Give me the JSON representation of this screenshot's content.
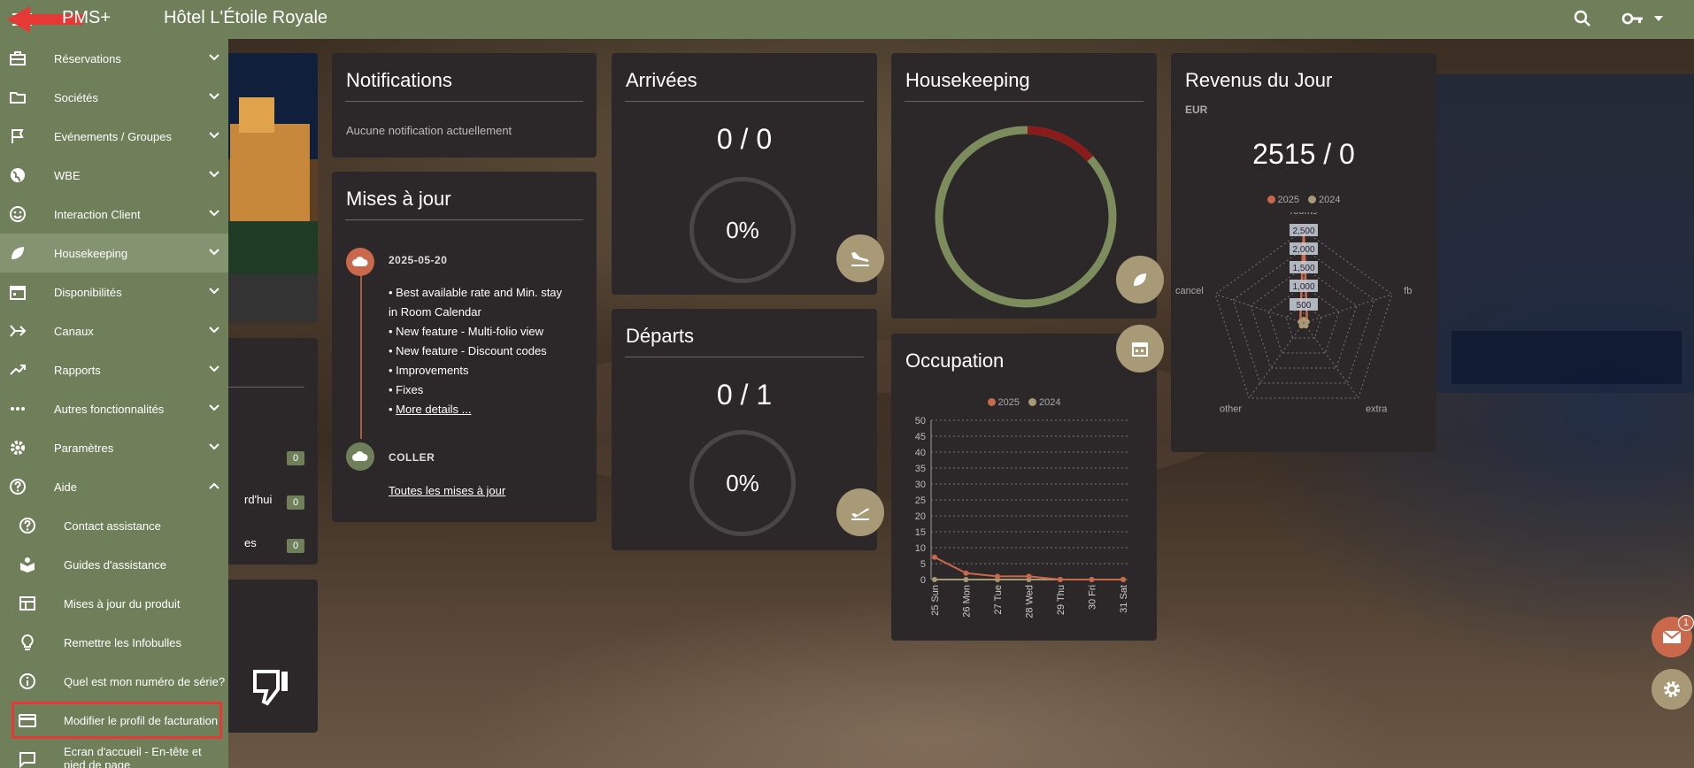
{
  "app": {
    "name": "PMS+",
    "hotel": "Hôtel L'Étoile Royale"
  },
  "colors": {
    "olive": "#6f7f5a",
    "accent": "#c9684a",
    "tan": "#a89a76",
    "red": "#8b1a1a"
  },
  "sidebar": {
    "items": [
      {
        "label": "Réservations",
        "icon": "briefcase-icon"
      },
      {
        "label": "Sociétés",
        "icon": "folder-icon"
      },
      {
        "label": "Evénements / Groupes",
        "icon": "flag-icon"
      },
      {
        "label": "WBE",
        "icon": "globe-icon"
      },
      {
        "label": "Interaction Client",
        "icon": "smiley-icon"
      },
      {
        "label": "Housekeeping",
        "icon": "leaf-icon"
      },
      {
        "label": "Disponibilités",
        "icon": "calendar-icon"
      },
      {
        "label": "Canaux",
        "icon": "channels-icon"
      },
      {
        "label": "Rapports",
        "icon": "trending-icon"
      },
      {
        "label": "Autres fonctionnalités",
        "icon": "more-icon"
      },
      {
        "label": "Paramètres",
        "icon": "gear-icon"
      },
      {
        "label": "Aide",
        "icon": "help-icon"
      }
    ],
    "help_items": [
      {
        "label": "Contact assistance",
        "icon": "help-circle-icon"
      },
      {
        "label": "Guides d'assistance",
        "icon": "book-icon"
      },
      {
        "label": "Mises à jour du produit",
        "icon": "table-icon"
      },
      {
        "label": "Remettre les Infobulles",
        "icon": "bulb-icon"
      },
      {
        "label": "Quel est mon numéro de série?",
        "icon": "info-icon"
      },
      {
        "label": "Modifier le profil de facturation",
        "icon": "credit-card-icon"
      },
      {
        "label": "Ecran d'accueil - En-tête et pied de page",
        "icon": "message-icon"
      }
    ]
  },
  "partial": {
    "today_text": "rd'hui",
    "es_text": "es",
    "badges": [
      "0",
      "0",
      "0"
    ]
  },
  "notifications": {
    "title": "Notifications",
    "empty": "Aucune notification actuellement"
  },
  "updates": {
    "title": "Mises à jour",
    "date": "2025-05-20",
    "lines": [
      "• Best available rate and Min. stay",
      "in Room Calendar",
      "• New feature - Multi-folio view",
      "• New feature - Discount codes",
      "• Improvements",
      "• Fixes"
    ],
    "more_prefix": "• ",
    "more": "More details ...",
    "coller": "COLLER",
    "all": "Toutes les mises à jour"
  },
  "arrivals": {
    "title": "Arrivées",
    "value": "0 / 0",
    "percent": "0%"
  },
  "departures": {
    "title": "Départs",
    "value": "0 / 1",
    "percent": "0%"
  },
  "housekeeping": {
    "title": "Housekeeping",
    "dirty_fraction": 0.13
  },
  "occupation": {
    "title": "Occupation"
  },
  "revenue": {
    "title": "Revenus du Jour",
    "currency": "EUR",
    "value": "2515 / 0"
  },
  "mail": {
    "count": "1"
  },
  "chart_data": [
    {
      "type": "line",
      "title": "Occupation",
      "series": [
        {
          "name": "2025",
          "values": [
            7,
            2,
            1,
            1,
            0,
            0,
            0
          ]
        },
        {
          "name": "2024",
          "values": [
            0,
            0,
            0,
            0,
            0,
            0,
            0
          ]
        }
      ],
      "categories": [
        "25 Sun",
        "26 Mon",
        "27 Tue",
        "28 Wed",
        "29 Thu",
        "30 Fri",
        "31 Sat"
      ],
      "yticks": [
        "0",
        "5",
        "10",
        "15",
        "20",
        "25",
        "30",
        "35",
        "40",
        "45",
        "50"
      ],
      "ylim": [
        0,
        50
      ]
    },
    {
      "type": "radar",
      "axes": [
        "rooms",
        "fb",
        "extra",
        "other",
        "cancel"
      ],
      "rticks": [
        "500",
        "1,000",
        "1,500",
        "2,000",
        "2,500"
      ],
      "max": 2500,
      "series": [
        {
          "name": "2025",
          "values": [
            2515,
            0,
            0,
            0,
            0
          ]
        },
        {
          "name": "2024",
          "values": [
            0,
            0,
            0,
            0,
            0
          ]
        }
      ]
    }
  ]
}
